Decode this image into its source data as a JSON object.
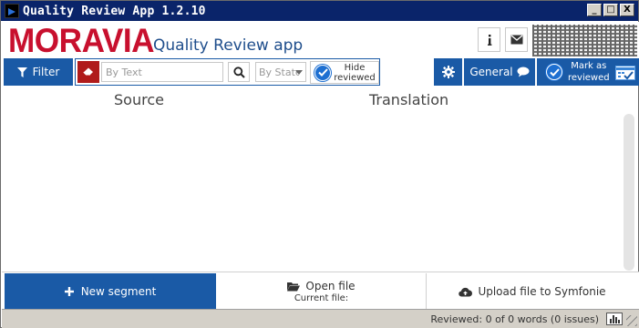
{
  "window": {
    "title": "Quality Review App 1.2.10",
    "controls": {
      "minimize": "_",
      "maximize": "□",
      "close": "X"
    }
  },
  "header": {
    "logo": "MORAVIA",
    "subtitle": "Quality Review app",
    "info_icon": "info-icon",
    "mail_icon": "mail-icon"
  },
  "toolbar": {
    "filter_label": "Filter",
    "text_placeholder": "By Text",
    "state_placeholder": "By State",
    "hide_reviewed_line1": "Hide",
    "hide_reviewed_line2": "reviewed",
    "general_label": "General",
    "mark_line1": "Mark as",
    "mark_line2": "reviewed"
  },
  "grid": {
    "source_header": "Source",
    "translation_header": "Translation"
  },
  "actions": {
    "new_segment": "New segment",
    "open_file": "Open file",
    "current_file": "Current file:",
    "upload": "Upload file to Symfonie"
  },
  "status": {
    "text": "Reviewed: 0 of 0 words (0 issues)"
  },
  "colors": {
    "brand_red": "#c8102e",
    "accent_blue": "#1a5aa6",
    "title_bar": "#0a246a"
  }
}
